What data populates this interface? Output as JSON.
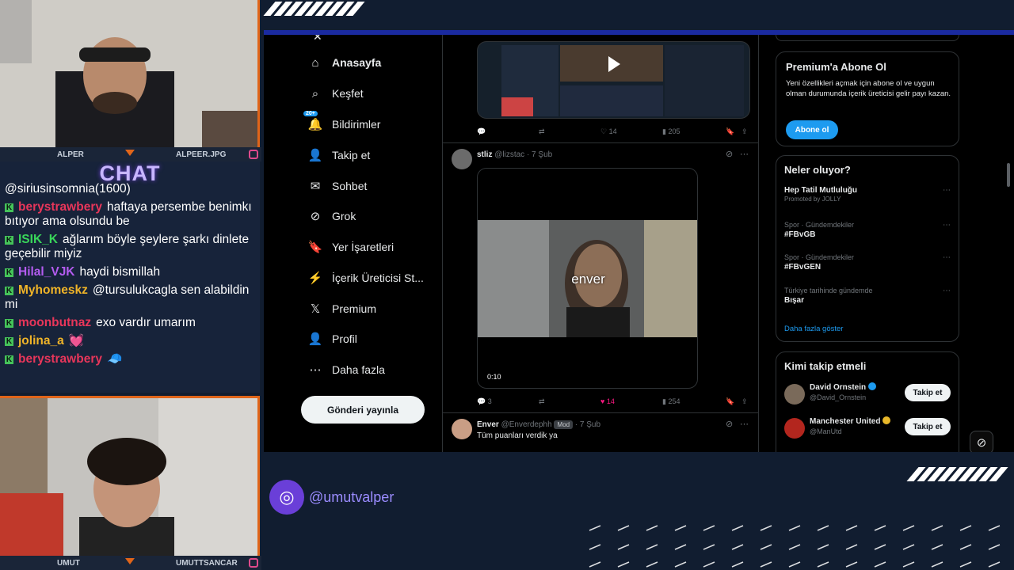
{
  "overlay": {
    "top_cam": {
      "left_name": "ALPER",
      "right_name": "ALPEER.JPG"
    },
    "bottom_cam": {
      "left_name": "UMUT",
      "right_name": "UMUTTSANCAR"
    },
    "chat_title": "CHAT",
    "handle": "@umutvalper",
    "accent_color": "#e0651a"
  },
  "chat": {
    "messages": [
      {
        "user": "",
        "text": "@siriusinsomnia(1600)",
        "color": "#ffffff"
      },
      {
        "user": "berystrawbery",
        "text": "haftaya persembe benimkı bıtıyor ama olsundu be",
        "color": "#e8365a"
      },
      {
        "user": "ISIK_K",
        "text": "ağlarım böyle şeylere şarkı dinlete geçebilir miyiz",
        "color": "#39d65a"
      },
      {
        "user": "Hilal_VJK",
        "text": "haydi bismillah",
        "color": "#b45cf0"
      },
      {
        "user": "Myhomeskz",
        "text": "@tursulukcagla sen alabildin mi",
        "color": "#f0b428"
      },
      {
        "user": "moonbutnaz",
        "text": "exo vardır umarım",
        "color": "#e8365a"
      },
      {
        "user": "jolina_a",
        "text": "💓",
        "color": "#f0b428"
      },
      {
        "user": "berystrawbery",
        "text": "🧢",
        "color": "#e8365a"
      }
    ]
  },
  "twitter": {
    "nav": [
      {
        "label": "Anasayfa",
        "icon": "home-icon",
        "glyph": "⌂",
        "active": true
      },
      {
        "label": "Keşfet",
        "icon": "search-icon",
        "glyph": "⌕"
      },
      {
        "label": "Bildirimler",
        "icon": "bell-icon",
        "glyph": "🔔",
        "badge": "20+"
      },
      {
        "label": "Takip et",
        "icon": "person-add-icon",
        "glyph": "👤"
      },
      {
        "label": "Sohbet",
        "icon": "mail-icon",
        "glyph": "✉"
      },
      {
        "label": "Grok",
        "icon": "grok-icon",
        "glyph": "⊘"
      },
      {
        "label": "Yer İşaretleri",
        "icon": "bookmark-icon",
        "glyph": "🔖"
      },
      {
        "label": "İçerik Üreticisi St...",
        "icon": "creator-studio-icon",
        "glyph": "⚡"
      },
      {
        "label": "Premium",
        "icon": "x-logo-icon",
        "glyph": "𝕏"
      },
      {
        "label": "Profil",
        "icon": "profile-icon",
        "glyph": "👤"
      },
      {
        "label": "Daha fazla",
        "icon": "more-circle-icon",
        "glyph": "⋯"
      }
    ],
    "post_button": "Gönderi yayınla",
    "tweet1_actions": {
      "likes": "14",
      "views": "205"
    },
    "tweet2": {
      "name": "stliz",
      "handle": "@lizstac",
      "date": "· 7 Şub",
      "video_caption": "enver",
      "video_time": "0:10",
      "replies": "3",
      "likes": "14",
      "views": "254"
    },
    "tweet3": {
      "name": "Enver",
      "handle": "@Enverdephh",
      "badge": "Mod",
      "date": "· 7 Şub",
      "text": "Tüm puanları verdik ya"
    },
    "premium": {
      "title": "Premium'a Abone Ol",
      "text": "Yeni özellikleri açmak için abone ol ve uygun olman durumunda içerik üreticisi gelir payı kazan.",
      "button": "Abone ol"
    },
    "trends": {
      "title": "Neler oluyor?",
      "items": [
        {
          "meta": "",
          "name": "Hep Tatil Mutluluğu",
          "sub": "Promoted by JOLLY"
        },
        {
          "meta": "Spor · Gündemdekiler",
          "name": "#FBvGB",
          "sub": ""
        },
        {
          "meta": "Spor · Gündemdekiler",
          "name": "#FBvGEN",
          "sub": ""
        },
        {
          "meta": "Türkiye tarihinde gündemde",
          "name": "Bışar",
          "sub": ""
        }
      ],
      "show_more": "Daha fazla göster"
    },
    "who_to_follow": {
      "title": "Kimi takip etmeli",
      "accounts": [
        {
          "name": "David Ornstein",
          "handle": "@David_Ornstein",
          "button": "Takip et",
          "verified": "blue"
        },
        {
          "name": "Manchester United",
          "handle": "@ManUtd",
          "button": "Takip et",
          "verified": "gold"
        }
      ]
    }
  }
}
